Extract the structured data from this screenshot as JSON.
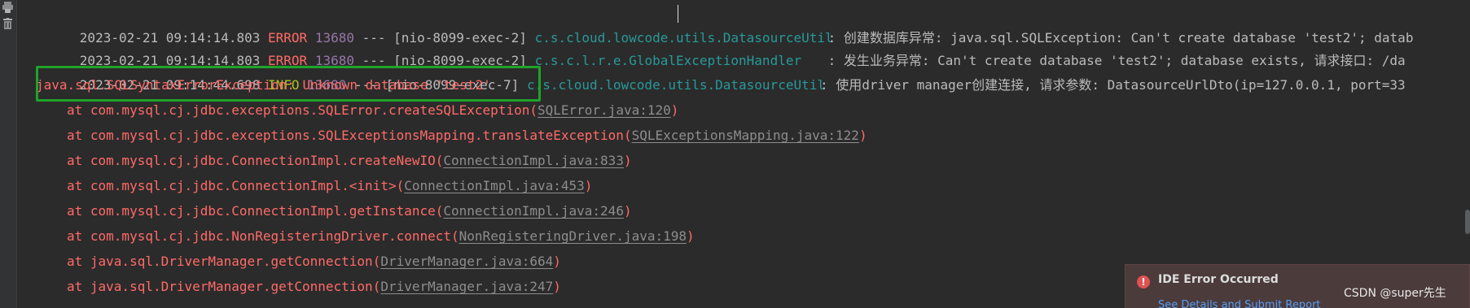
{
  "log_lines": [
    {
      "timestamp": "2023-02-21 09:14:14.803",
      "level": "ERROR",
      "pid": "13680",
      "separator": "---",
      "thread": "[nio-8099-exec-2]",
      "logger": "c.s.cloud.lowcode.utils.DatasourceUtil",
      "message": ": 创建数据库异常: java.sql.SQLException: Can't create database 'test2'; datab"
    },
    {
      "timestamp": "2023-02-21 09:14:14.803",
      "level": "ERROR",
      "pid": "13680",
      "separator": "---",
      "thread": "[nio-8099-exec-2]",
      "logger": "c.s.c.l.r.e.GlobalExceptionHandler",
      "message": ": 发生业务异常: Can't create database 'test2'; database exists, 请求接口: /da"
    },
    {
      "timestamp": "2023-02-21 09:14:44.698",
      "level": "INFO",
      "pid": "13680",
      "separator": "---",
      "thread": "[nio-8099-exec-7]",
      "logger": "c.s.cloud.lowcode.utils.DatasourceUtil",
      "message": ": 使用driver manager创建连接, 请求参数: DatasourceUrlDto(ip=127.0.0.1, port=33"
    }
  ],
  "exception": "java.sql.SQLSyntaxErrorException: Unknown database 'test2'",
  "stack_trace": [
    {
      "prefix": "at com.mysql.cj.jdbc.exceptions.SQLError.createSQLException",
      "location": "SQLError.java:120"
    },
    {
      "prefix": "at com.mysql.cj.jdbc.exceptions.SQLExceptionsMapping.translateException",
      "location": "SQLExceptionsMapping.java:122"
    },
    {
      "prefix": "at com.mysql.cj.jdbc.ConnectionImpl.createNewIO",
      "location": "ConnectionImpl.java:833"
    },
    {
      "prefix": "at com.mysql.cj.jdbc.ConnectionImpl.<init>",
      "location": "ConnectionImpl.java:453"
    },
    {
      "prefix": "at com.mysql.cj.jdbc.ConnectionImpl.getInstance",
      "location": "ConnectionImpl.java:246"
    },
    {
      "prefix": "at com.mysql.cj.jdbc.NonRegisteringDriver.connect",
      "location": "NonRegisteringDriver.java:198"
    },
    {
      "prefix": "at java.sql.DriverManager.getConnection",
      "location": "DriverManager.java:664"
    },
    {
      "prefix": "at java.sql.DriverManager.getConnection",
      "location": "DriverManager.java:247"
    }
  ],
  "gutter_icons": [
    "print-icon",
    "trash-icon"
  ],
  "notification": {
    "title": "IDE Error Occurred",
    "link": "See Details and Submit Report",
    "icon": "error-icon"
  },
  "watermark": "CSDN @super先生",
  "colors": {
    "background": "#2b2b2b",
    "error": "#ff6b68",
    "info": "#a8c023",
    "logger": "#299999",
    "highlight_box": "#1fa32a"
  }
}
